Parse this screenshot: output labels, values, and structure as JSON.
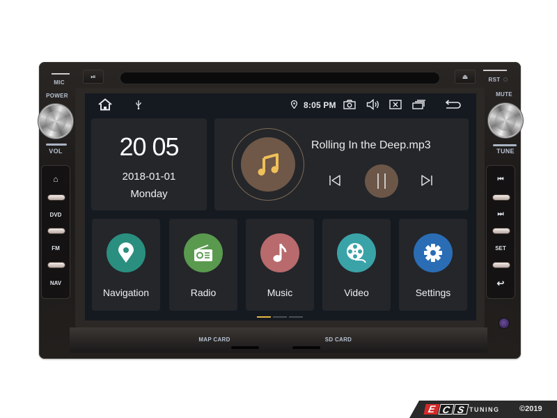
{
  "device": {
    "top_left_labels": {
      "mic": "MIC",
      "power": "POWER",
      "vol": "VOL"
    },
    "top_right_labels": {
      "rst": "RST",
      "mute": "MUTE",
      "tune": "TUNE"
    },
    "top_buttons": {
      "play_pause_icon": "⏯",
      "eject_icon": "⏏"
    },
    "left_panel": [
      {
        "label": "⌂",
        "icon": "home-icon"
      },
      {
        "label": "DVD"
      },
      {
        "label": "FM"
      },
      {
        "label": "NAV"
      }
    ],
    "right_panel": [
      {
        "label": "⏮",
        "icon": "previous-track-icon"
      },
      {
        "label": "⏭",
        "icon": "next-track-icon"
      },
      {
        "label": "SET"
      },
      {
        "label": "↩",
        "icon": "back-icon"
      }
    ],
    "bottom_labels": {
      "map_card": "MAP CARD",
      "sd_card": "SD CARD"
    }
  },
  "status_bar": {
    "time": "8:05 PM",
    "icons": [
      "home-icon",
      "usb-icon",
      "location-icon",
      "camera-icon",
      "volume-icon",
      "close-window-icon",
      "recent-apps-icon",
      "back-icon"
    ]
  },
  "clock_widget": {
    "time": "20 05",
    "date": "2018-01-01",
    "weekday": "Monday"
  },
  "music_widget": {
    "track": "Rolling In the Deep.mp3",
    "state": "playing",
    "accent": "#6f5848",
    "note_color": "#f0c05a"
  },
  "apps": [
    {
      "label": "Navigation",
      "icon": "map-pin-icon",
      "color": "#2b8f80"
    },
    {
      "label": "Radio",
      "icon": "radio-icon",
      "color": "#5a9a4f"
    },
    {
      "label": "Music",
      "icon": "music-note-icon",
      "color": "#b86a6c"
    },
    {
      "label": "Video",
      "icon": "film-reel-icon",
      "color": "#3aa3a8"
    },
    {
      "label": "Settings",
      "icon": "gear-icon",
      "color": "#2a6db5"
    }
  ],
  "page_indicator": {
    "count": 3,
    "active": 0,
    "active_color": "#e7b945",
    "inactive_color": "#4a4e55"
  },
  "watermark": {
    "letters": [
      "E",
      "C",
      "S"
    ],
    "tuning": "TUNING",
    "copyright": "©2019"
  }
}
